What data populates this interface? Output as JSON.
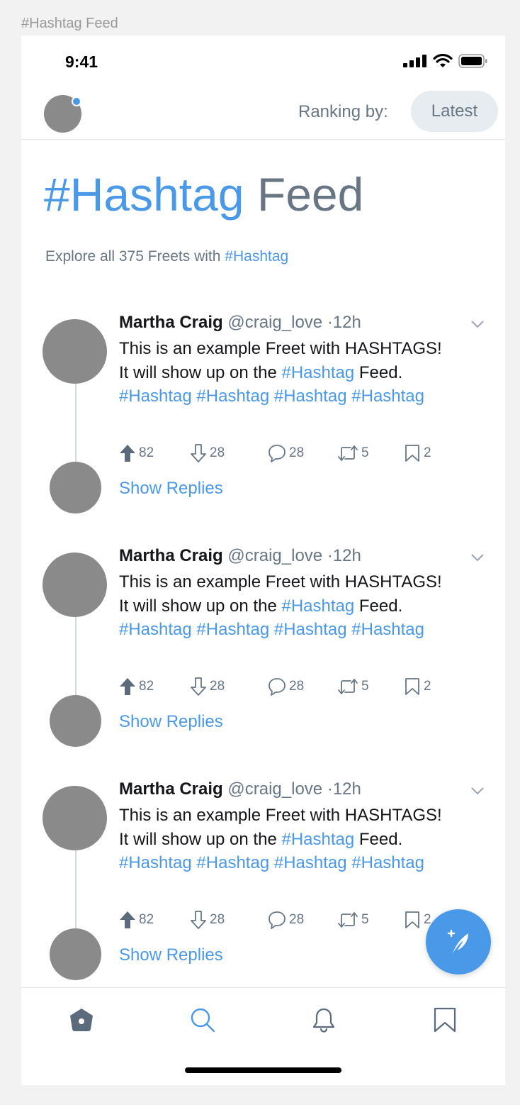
{
  "frame_label": "#Hashtag Feed",
  "status_bar": {
    "time": "9:41"
  },
  "nav": {
    "ranking_label": "Ranking by:",
    "ranking_value": "Latest"
  },
  "page": {
    "title_tag": "#Hashtag",
    "title_rest": "Feed",
    "subtitle_prefix": "Explore all 375 Freets with",
    "subtitle_tag": "#Hashtag"
  },
  "freets": [
    {
      "author": "Martha Craig",
      "handle": "@craig_love",
      "time": "·12h",
      "text_1": "This is an example Freet with HASHTAGS! It will show up on the",
      "tag_1": "#Hashtag",
      "text_2": "Feed.",
      "tag_2": "#Hashtag",
      "tag_3": "#Hashtag",
      "tag_4": "#Hashtag",
      "tag_5": "#Hashtag",
      "upvotes": "82",
      "downvotes": "28",
      "comments": "28",
      "refreets": "5",
      "bookmarks": "2",
      "show_replies": "Show Replies"
    },
    {
      "author": "Martha Craig",
      "handle": "@craig_love",
      "time": "·12h",
      "text_1": "This is an example Freet with HASHTAGS! It will show up on the",
      "tag_1": "#Hashtag",
      "text_2": "Feed.",
      "tag_2": "#Hashtag",
      "tag_3": "#Hashtag",
      "tag_4": "#Hashtag",
      "tag_5": "#Hashtag",
      "upvotes": "82",
      "downvotes": "28",
      "comments": "28",
      "refreets": "5",
      "bookmarks": "2",
      "show_replies": "Show Replies"
    },
    {
      "author": "Martha Craig",
      "handle": "@craig_love",
      "time": "·12h",
      "text_1": "This is an example Freet with HASHTAGS! It will show up on the",
      "tag_1": "#Hashtag",
      "text_2": "Feed.",
      "tag_2": "#Hashtag",
      "tag_3": "#Hashtag",
      "tag_4": "#Hashtag",
      "tag_5": "#Hashtag",
      "upvotes": "82",
      "downvotes": "28",
      "comments": "28",
      "refreets": "5",
      "bookmarks": "2",
      "show_replies": "Show Replies"
    }
  ],
  "fab": {
    "icon": "compose-feather-icon"
  },
  "tab_bar": {
    "items": [
      {
        "icon": "home-icon",
        "active": false
      },
      {
        "icon": "search-icon",
        "active": true
      },
      {
        "icon": "bell-icon",
        "active": false
      },
      {
        "icon": "bookmark-icon",
        "active": false
      }
    ]
  },
  "colors": {
    "accent": "#4a99e9",
    "secondary_text": "#687684",
    "primary_text": "#141619",
    "avatar": "#8a8a8a"
  }
}
